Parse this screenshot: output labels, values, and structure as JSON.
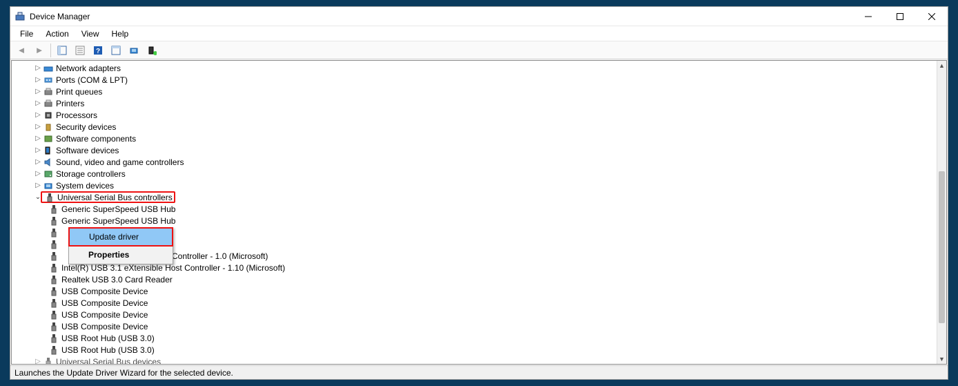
{
  "window": {
    "title": "Device Manager"
  },
  "menus": {
    "file": "File",
    "action": "Action",
    "view": "View",
    "help": "Help"
  },
  "tree": {
    "items": [
      {
        "label": "Network adapters",
        "icon": "net"
      },
      {
        "label": "Ports (COM & LPT)",
        "icon": "port"
      },
      {
        "label": "Print queues",
        "icon": "printer"
      },
      {
        "label": "Printers",
        "icon": "printer"
      },
      {
        "label": "Processors",
        "icon": "cpu"
      },
      {
        "label": "Security devices",
        "icon": "sec"
      },
      {
        "label": "Software components",
        "icon": "swc"
      },
      {
        "label": "Software devices",
        "icon": "swd"
      },
      {
        "label": "Sound, video and game controllers",
        "icon": "snd"
      },
      {
        "label": "Storage controllers",
        "icon": "stor"
      },
      {
        "label": "System devices",
        "icon": "sys"
      }
    ],
    "usb_category": "Universal Serial Bus controllers",
    "usb_children_top": [
      "Generic SuperSpeed USB Hub",
      "Generic SuperSpeed USB Hub"
    ],
    "usb_truncated_row": "Controller - 1.0 (Microsoft)",
    "usb_children_bottom": [
      "Intel(R) USB 3.1 eXtensible Host Controller - 1.10 (Microsoft)",
      "Realtek USB 3.0 Card Reader",
      "USB Composite Device",
      "USB Composite Device",
      "USB Composite Device",
      "USB Composite Device",
      "USB Root Hub (USB 3.0)",
      "USB Root Hub (USB 3.0)"
    ],
    "last_collapsed": "Universal Serial Bus devices"
  },
  "context_menu": {
    "update": "Update driver",
    "properties": "Properties"
  },
  "statusbar": "Launches the Update Driver Wizard for the selected device."
}
